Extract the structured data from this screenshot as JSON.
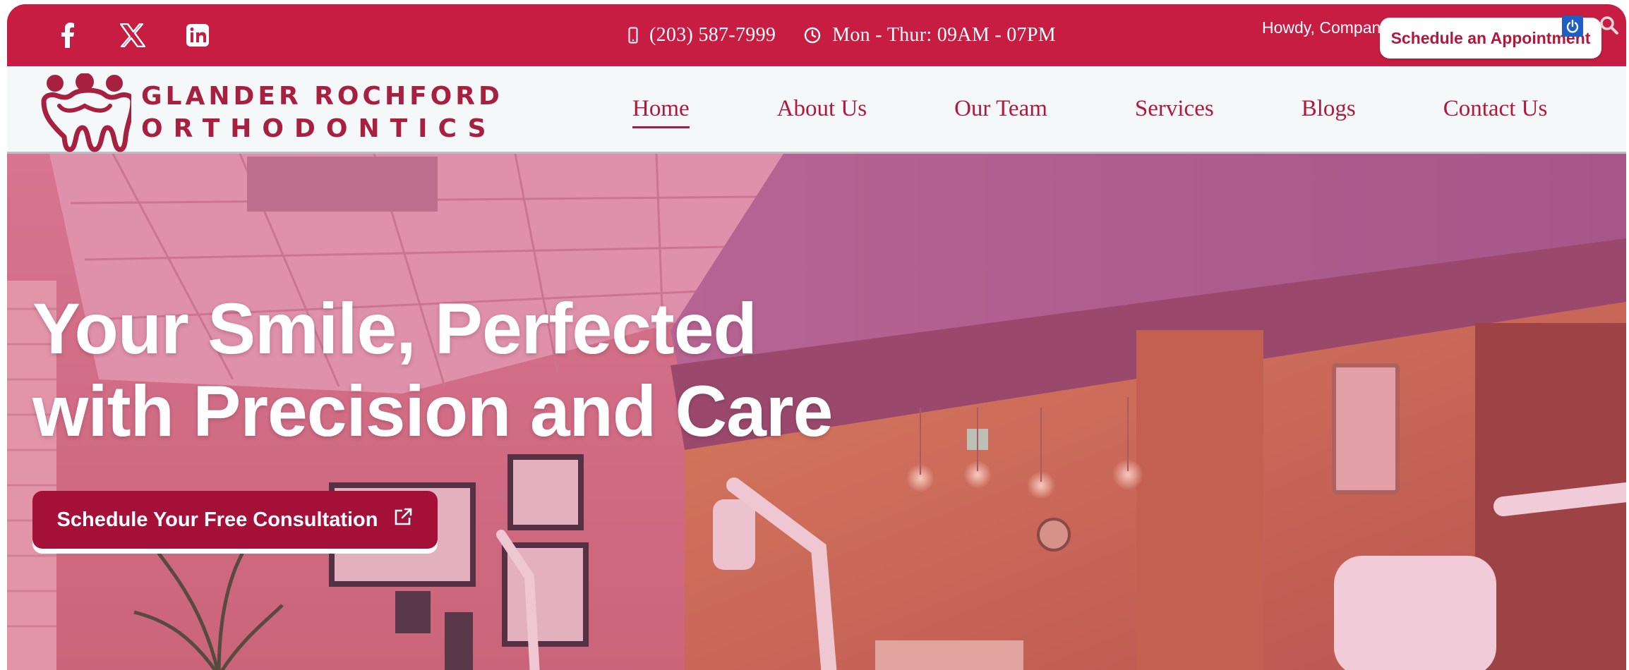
{
  "topbar": {
    "social": [
      {
        "name": "facebook-icon",
        "glyph": "f"
      },
      {
        "name": "x-twitter-icon",
        "glyph": "X"
      },
      {
        "name": "linkedin-icon",
        "glyph": "in"
      }
    ],
    "phone": "(203) 587-7999",
    "hours": "Mon - Thur: 09AM - 07PM",
    "admin_greeting": "Howdy, Compan",
    "schedule_label": "Schedule an Appointment"
  },
  "nav": {
    "logo_line1": "GLANDER ROCHFORD",
    "logo_line2": "ORTHODONTICS",
    "items": [
      {
        "label": "Home",
        "active": true
      },
      {
        "label": "About Us",
        "active": false
      },
      {
        "label": "Our Team",
        "active": false
      },
      {
        "label": "Services",
        "active": false
      },
      {
        "label": "Blogs",
        "active": false
      },
      {
        "label": "Contact Us",
        "active": false
      }
    ]
  },
  "hero": {
    "title_line1": "Your Smile, Perfected",
    "title_line2": "with Precision and Care",
    "cta_label": "Schedule Your Free Consultation"
  },
  "colors": {
    "brand": "#c81d43",
    "brand_dark": "#a51038",
    "nav_text": "#b3173b",
    "nav_bg": "#f4f8f9"
  }
}
